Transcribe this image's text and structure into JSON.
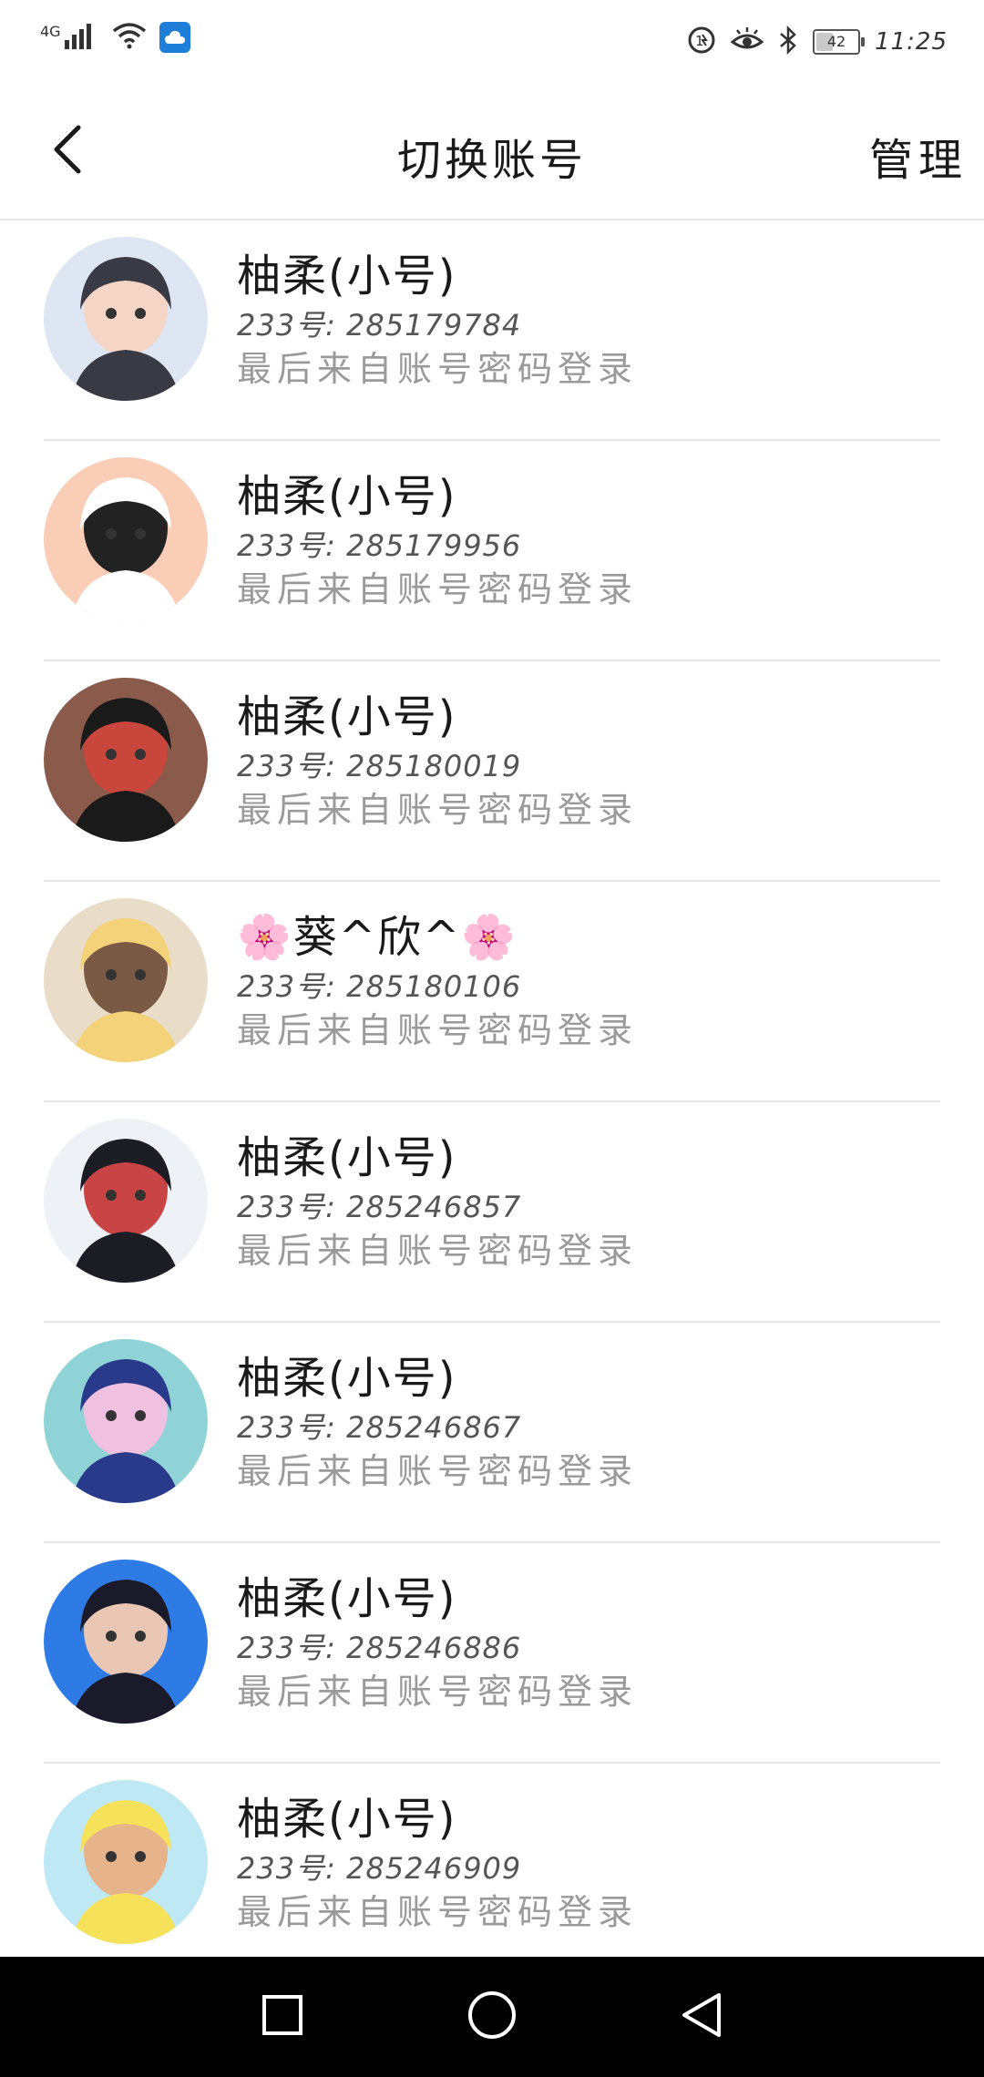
{
  "status_bar": {
    "network_label": "4G",
    "battery_level": "42",
    "battery_fraction": 0.42,
    "time": "11:25",
    "icons": [
      "signal-icon",
      "wifi-icon",
      "cloud-app-icon",
      "data-saver-icon",
      "eye-comfort-icon",
      "bluetooth-icon",
      "battery-icon"
    ]
  },
  "header": {
    "back_icon": "chevron-left-icon",
    "title": "切换账号",
    "manage_label": "管理"
  },
  "accounts": [
    {
      "name": "柚柔(小号)",
      "id_line": "233号: 285179784",
      "login_method": "最后来自账号密码登录",
      "avatar_colors": [
        "#dfe6f3",
        "#3a3a44",
        "#f5d6c6"
      ]
    },
    {
      "name": "柚柔(小号)",
      "id_line": "233号: 285179956",
      "login_method": "最后来自账号密码登录",
      "avatar_colors": [
        "#f9cdb6",
        "#ffffff",
        "#222222"
      ]
    },
    {
      "name": "柚柔(小号)",
      "id_line": "233号: 285180019",
      "login_method": "最后来自账号密码登录",
      "avatar_colors": [
        "#8a5a4a",
        "#1a1a1a",
        "#c9463d"
      ]
    },
    {
      "name": "🌸葵^欣^🌸",
      "id_line": "233号: 285180106",
      "login_method": "最后来自账号密码登录",
      "avatar_colors": [
        "#e9dcc8",
        "#f3d27a",
        "#7a5a45"
      ]
    },
    {
      "name": "柚柔(小号)",
      "id_line": "233号: 285246857",
      "login_method": "最后来自账号密码登录",
      "avatar_colors": [
        "#eef1f6",
        "#1c1c24",
        "#c94444"
      ]
    },
    {
      "name": "柚柔(小号)",
      "id_line": "233号: 285246867",
      "login_method": "最后来自账号密码登录",
      "avatar_colors": [
        "#8fd3d6",
        "#2a3a8a",
        "#f0c0e0"
      ]
    },
    {
      "name": "柚柔(小号)",
      "id_line": "233号: 285246886",
      "login_method": "最后来自账号密码登录",
      "avatar_colors": [
        "#2f7be6",
        "#1a1a2a",
        "#e9c7b4"
      ]
    },
    {
      "name": "柚柔(小号)",
      "id_line": "233号: 285246909",
      "login_method": "最后来自账号密码登录",
      "avatar_colors": [
        "#bfe8f5",
        "#f5e25a",
        "#e6b38a"
      ]
    }
  ],
  "nav_bar": {
    "buttons": [
      "recent-apps-icon",
      "home-icon",
      "back-triangle-icon"
    ]
  }
}
